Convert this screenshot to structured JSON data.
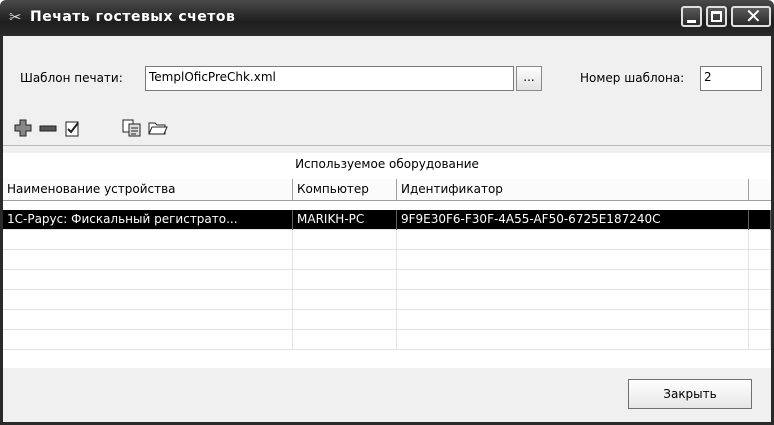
{
  "window": {
    "title": "Печать гостевых счетов",
    "icon": "tools-icon"
  },
  "form": {
    "template_label": "Шаблон печати:",
    "template_value": "TemplOficPreChk.xml",
    "browse_label": "...",
    "number_label": "Номер шаблона:",
    "number_value": "2"
  },
  "toolbar": {
    "icons": [
      "add-icon",
      "remove-icon",
      "edit-doc-icon",
      "copy-doc-icon",
      "open-folder-icon"
    ]
  },
  "grid": {
    "caption": "Используемое оборудование",
    "columns": [
      "Наименование устройства",
      "Компьютер",
      "Идентификатор"
    ],
    "rows": [
      [
        "1С-Рарус: Фискальный регистрато...",
        "MARIKH-PC",
        "9F9E30F6-F30F-4A55-AF50-6725E187240C"
      ]
    ],
    "selected_row": 0,
    "empty_rows": 6
  },
  "footer": {
    "close_label": "Закрыть"
  }
}
